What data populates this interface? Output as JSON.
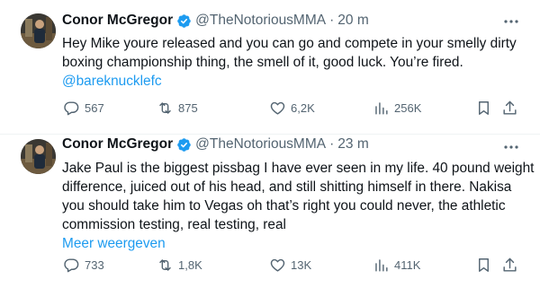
{
  "colors": {
    "accent": "#1d9bf0",
    "text": "#0f1419",
    "muted": "#536471",
    "divider": "#eff3f4"
  },
  "tweets": [
    {
      "name": "Conor McGregor",
      "handle": "@TheNotoriousMMA",
      "separator": "·",
      "time": "20 m",
      "text_lines": [
        "Hey Mike youre released and you can go and compete in your smelly dirty",
        "boxing championship thing, the smell of it, good luck. You’re fired."
      ],
      "mention": "@bareknucklefc",
      "stats": {
        "replies": "567",
        "retweets": "875",
        "likes": "6,2K",
        "views": "256K"
      }
    },
    {
      "name": "Conor McGregor",
      "handle": "@TheNotoriousMMA",
      "separator": "·",
      "time": "23 m",
      "text_lines": [
        "Jake Paul is the biggest pissbag I have ever seen in my life. 40 pound weight",
        "difference, juiced out of his head, and still shitting himself in there. Nakisa",
        "you should take him to Vegas oh that’s right you could never, the athletic",
        "commission testing, real testing, real"
      ],
      "show_more": "Meer weergeven",
      "stats": {
        "replies": "733",
        "retweets": "1,8K",
        "likes": "13K",
        "views": "411K"
      }
    }
  ],
  "icons": {
    "verified": "verified-badge-icon",
    "more": "more-dots-icon",
    "reply": "reply-icon",
    "retweet": "retweet-icon",
    "like": "heart-icon",
    "views": "views-chart-icon",
    "bookmark": "bookmark-icon",
    "share": "share-icon"
  }
}
